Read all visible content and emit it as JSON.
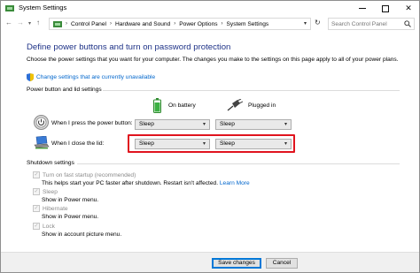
{
  "window": {
    "title": "System Settings"
  },
  "addressbar": {
    "breadcrumbs": [
      "Control Panel",
      "Hardware and Sound",
      "Power Options",
      "System Settings"
    ],
    "search_placeholder": "Search Control Panel"
  },
  "main": {
    "heading": "Define power buttons and turn on password protection",
    "description": "Choose the power settings that you want for your computer. The changes you make to the settings on this page apply to all of your power plans.",
    "change_settings_link": "Change settings that are currently unavailable"
  },
  "power_buttons": {
    "group_title": "Power button and lid settings",
    "columns": [
      "On battery",
      "Plugged in"
    ],
    "rows": [
      {
        "label": "When I press the power button:",
        "on_battery": "Sleep",
        "plugged_in": "Sleep"
      },
      {
        "label": "When I close the lid:",
        "on_battery": "Sleep",
        "plugged_in": "Sleep"
      }
    ]
  },
  "shutdown": {
    "group_title": "Shutdown settings",
    "items": [
      {
        "label": "Turn on fast startup (recommended)",
        "checked": true,
        "description": "This helps start your PC faster after shutdown. Restart isn't affected.",
        "link": "Learn More"
      },
      {
        "label": "Sleep",
        "checked": true,
        "description": "Show in Power menu."
      },
      {
        "label": "Hibernate",
        "checked": true,
        "description": "Show in Power menu."
      },
      {
        "label": "Lock",
        "checked": true,
        "description": "Show in account picture menu."
      }
    ]
  },
  "footer": {
    "save_label": "Save changes",
    "cancel_label": "Cancel"
  },
  "colors": {
    "heading": "#1e3287",
    "link": "#0066cc",
    "highlight": "#e0141e",
    "disabled_text": "#8a8a8a"
  }
}
